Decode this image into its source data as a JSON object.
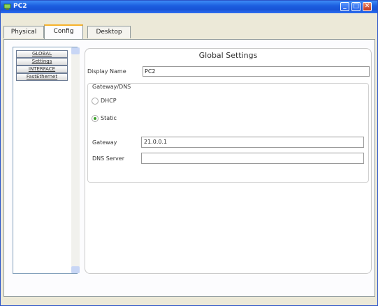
{
  "window": {
    "title": "PC2"
  },
  "tabs": [
    {
      "label": "Physical"
    },
    {
      "label": "Config"
    },
    {
      "label": "Desktop"
    }
  ],
  "sidebar": {
    "items": [
      {
        "label": "GLOBAL"
      },
      {
        "label": "Settings"
      },
      {
        "label": "INTERFACE"
      },
      {
        "label": "FastEthernet"
      }
    ]
  },
  "global_settings": {
    "title": "Global Settings",
    "display_name_label": "Display Name",
    "display_name_value": "PC2",
    "gateway_dns_label": "Gateway/DNS",
    "dhcp_label": "DHCP",
    "static_label": "Static",
    "selected_mode": "Static",
    "gateway_label": "Gateway",
    "gateway_value": "21.0.0.1",
    "dns_server_label": "DNS Server",
    "dns_server_value": ""
  },
  "colors": {
    "titlebar": "#1c5fe0",
    "active_tab_accent": "#f7b22a",
    "radio_selected": "#3aa12b"
  }
}
